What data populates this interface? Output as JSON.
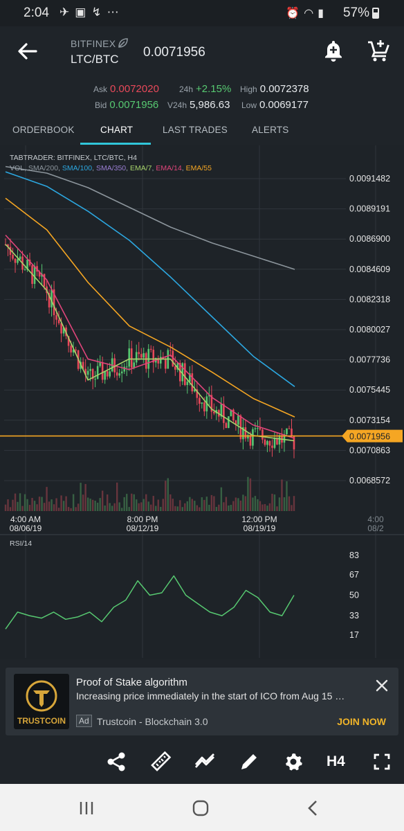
{
  "status_bar": {
    "time": "2:04",
    "left_icons": [
      "telegram-icon",
      "gallery-icon",
      "network-speed-icon",
      "more-icon"
    ],
    "right_icons": [
      "alarm-icon",
      "wifi-icon",
      "signal-icon"
    ],
    "battery": "57%"
  },
  "header": {
    "exchange": "BITFINEX",
    "pair": "LTC/BTC",
    "last_price": "0.0071956"
  },
  "quotes": {
    "ask_label": "Ask",
    "ask_value": "0.0072020",
    "bid_label": "Bid",
    "bid_value": "0.0071956",
    "change_label": "24h",
    "change_value": "+2.15%",
    "volume_label": "V24h",
    "volume_value": "5,986.63",
    "high_label": "High",
    "high_value": "0.0072378",
    "low_label": "Low",
    "low_value": "0.0069177"
  },
  "tabs": [
    {
      "label": "ORDERBOOK",
      "active": false
    },
    {
      "label": "CHART",
      "active": true
    },
    {
      "label": "LAST TRADES",
      "active": false
    },
    {
      "label": "ALERTS",
      "active": false
    }
  ],
  "chart": {
    "source_label": "TABTRADER: BITFINEX, LTC/BTC, H4",
    "indicators": [
      {
        "label": "VOL",
        "color": "#9aa3ab"
      },
      {
        "label": "SMA/200",
        "color": "#8c959c"
      },
      {
        "label": "SMA/100",
        "color": "#2ca7e0"
      },
      {
        "label": "SMA/350",
        "color": "#9b7fd4"
      },
      {
        "label": "EMA/7",
        "color": "#a6d36b"
      },
      {
        "label": "EMA/14",
        "color": "#e0457b"
      },
      {
        "label": "EMA/55",
        "color": "#f5a623"
      }
    ],
    "price_ticks": [
      "0.0091482",
      "0.0089191",
      "0.0086900",
      "0.0084609",
      "0.0082318",
      "0.0080027",
      "0.0077736",
      "0.0075445",
      "0.0073154",
      "0.0070863",
      "0.0068572"
    ],
    "current_price_tag": "0.0071956",
    "time_ticks": [
      {
        "time": "4:00 AM",
        "date": "08/06/19"
      },
      {
        "time": "8:00 PM",
        "date": "08/12/19"
      },
      {
        "time": "12:00 PM",
        "date": "08/19/19"
      },
      {
        "time": "4:00",
        "date": "08/2"
      }
    ],
    "rsi_label": "RSI/14",
    "rsi_ticks": [
      "83",
      "67",
      "50",
      "33",
      "17"
    ],
    "colors": {
      "up": "#57c971",
      "down": "#e8495a",
      "price_line": "#f5a623"
    }
  },
  "chart_data": [
    {
      "type": "line",
      "title": "TABTRADER: BITFINEX, LTC/BTC, H4",
      "ylim": [
        0.0068,
        0.0092
      ],
      "x_ticks": [
        "08/06/19 4:00 AM",
        "08/12/19 8:00 PM",
        "08/19/19 12:00 PM"
      ],
      "series": [
        {
          "name": "SMA/200",
          "values": [
            0.00924,
            0.00919,
            0.00908,
            0.00893,
            0.00878,
            0.00866,
            0.00856,
            0.00846
          ]
        },
        {
          "name": "SMA/100",
          "values": [
            0.0092,
            0.00909,
            0.0089,
            0.00868,
            0.0084,
            0.0081,
            0.0078,
            0.00757
          ]
        },
        {
          "name": "EMA/55",
          "values": [
            0.009,
            0.00876,
            0.00836,
            0.00803,
            0.00787,
            0.00768,
            0.00748,
            0.00734
          ]
        },
        {
          "name": "EMA/14",
          "values": [
            0.00872,
            0.00838,
            0.00778,
            0.0077,
            0.00781,
            0.00749,
            0.00728,
            0.00718
          ]
        },
        {
          "name": "EMA/7",
          "values": [
            0.00865,
            0.0083,
            0.00762,
            0.00778,
            0.00778,
            0.0074,
            0.0072,
            0.00716
          ]
        }
      ],
      "current_price": 0.0071956
    },
    {
      "type": "line",
      "title": "RSI/14",
      "ylim": [
        17,
        83
      ],
      "series": [
        {
          "name": "RSI/14",
          "values": [
            22,
            36,
            33,
            31,
            36,
            30,
            32,
            36,
            28,
            40,
            46,
            62,
            50,
            52,
            66,
            50,
            43,
            36,
            33,
            40,
            54,
            48,
            36,
            33,
            50
          ]
        }
      ]
    }
  ],
  "ad": {
    "logo_text": "TRUSTCOIN",
    "title": "Proof of Stake algorithm",
    "description": "Increasing price immediately in the start of ICO from Aug 15 …",
    "badge": "Ad",
    "source": "Trustcoin - Blockchain 3.0",
    "cta": "JOIN NOW"
  },
  "toolbar": {
    "items": [
      "share-icon",
      "ruler-icon",
      "indicators-icon",
      "draw-icon",
      "settings-icon"
    ],
    "timeframe": "H4"
  }
}
